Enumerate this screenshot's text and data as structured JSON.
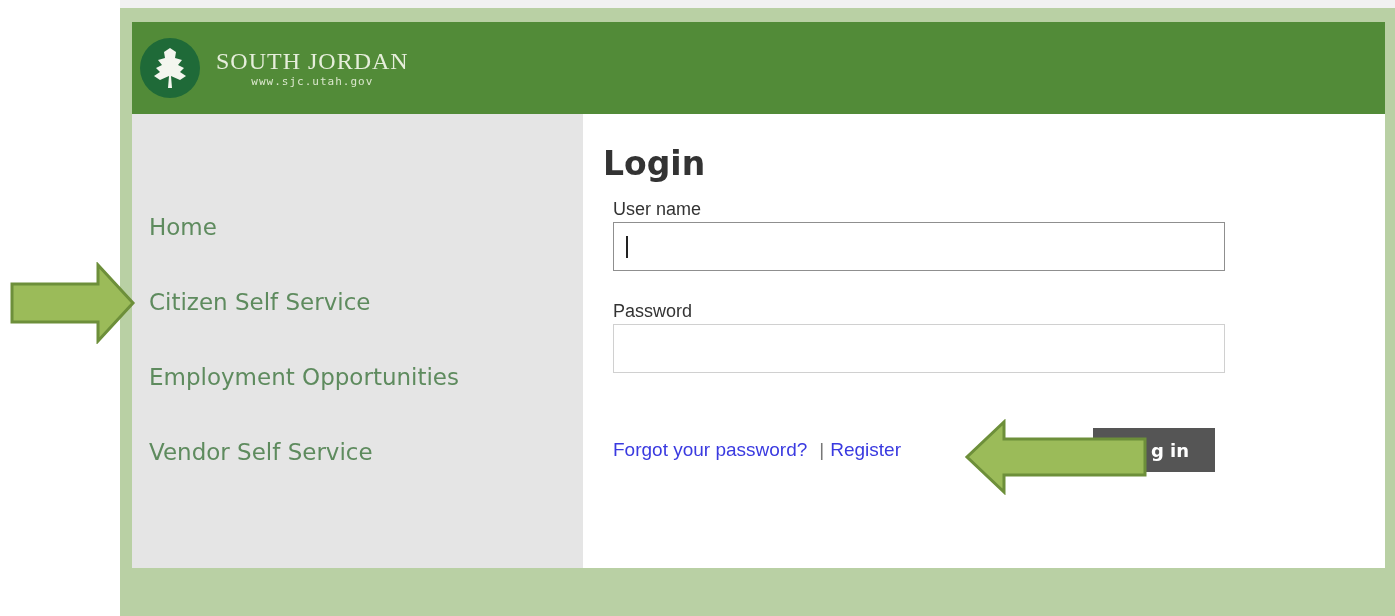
{
  "header": {
    "logo_title": "SOUTH JORDAN",
    "logo_url": "www.sjc.utah.gov"
  },
  "sidebar": {
    "items": [
      {
        "label": "Home"
      },
      {
        "label": "Citizen Self Service"
      },
      {
        "label": "Employment Opportunities"
      },
      {
        "label": "Vendor Self Service"
      }
    ]
  },
  "login": {
    "title": "Login",
    "fields": [
      {
        "label": "User name",
        "focused": true
      },
      {
        "label": "Password",
        "focused": false
      }
    ],
    "links": [
      "Forgot your password?",
      "Register"
    ],
    "separator": "|",
    "button": "g in"
  },
  "annotations": [
    {
      "kind": "arrow_right"
    },
    {
      "kind": "arrow_left"
    }
  ]
}
